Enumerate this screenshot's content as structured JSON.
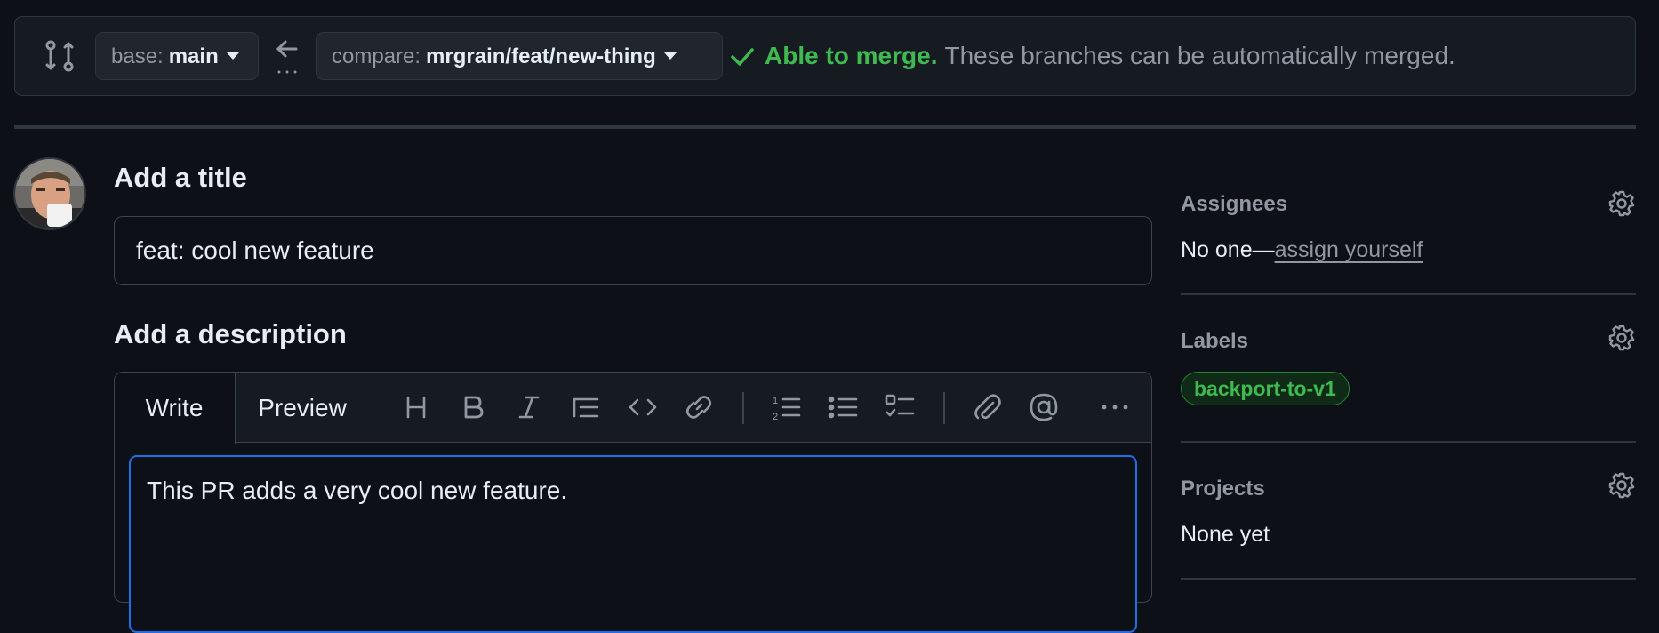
{
  "compare_bar": {
    "base_prefix": "base:",
    "base_branch": "main",
    "compare_prefix": "compare:",
    "compare_branch": "mrgrain/feat/new-thing",
    "merge_status": "Able to merge.",
    "merge_message": "These branches can be automatically merged."
  },
  "form": {
    "title_heading": "Add a title",
    "title_value": "feat: cool new feature",
    "description_heading": "Add a description",
    "tabs": [
      "Write",
      "Preview"
    ],
    "toolbar": [
      "heading-icon",
      "bold-icon",
      "italic-icon",
      "quote-icon",
      "code-icon",
      "link-icon",
      "ordered-list-icon",
      "unordered-list-icon",
      "task-list-icon",
      "attach-icon",
      "mention-icon",
      "more-icon"
    ],
    "description_value": "This PR adds a very cool new feature."
  },
  "sidebar": {
    "assignees": {
      "title": "Assignees",
      "value": "No one—",
      "link": "assign yourself"
    },
    "labels": {
      "title": "Labels",
      "items": [
        "backport-to-v1"
      ]
    },
    "projects": {
      "title": "Projects",
      "value": "None yet"
    }
  },
  "colors": {
    "background": "#0d1117",
    "success": "#3fb950",
    "focus": "#1f6feb",
    "muted": "#9198a1"
  }
}
